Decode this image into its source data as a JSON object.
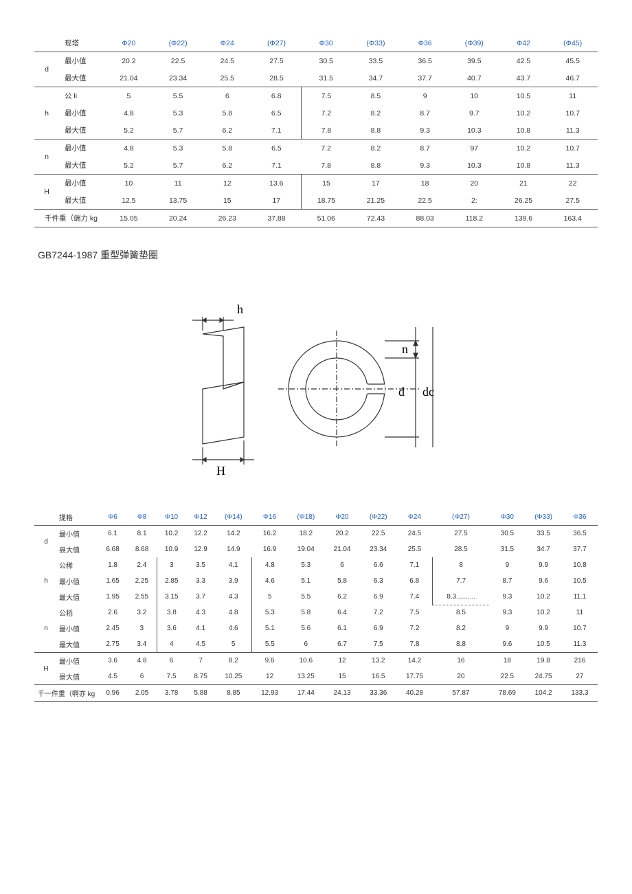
{
  "table1": {
    "header_label": "现塔",
    "headers": [
      "Φ20",
      "(Φ22)",
      "Φ24",
      "(Φ27)",
      "Φ30",
      "(Φ33)",
      "Φ36",
      "(Φ39)",
      "Φ42",
      "(Φ45)"
    ],
    "params": [
      {
        "name": "d",
        "rows": [
          {
            "label": "最小值",
            "values": [
              "20.2",
              "22.5",
              "24.5",
              "27.5",
              "30.5",
              "33.5",
              "36.5",
              "39.5",
              "42.5",
              "45.5"
            ]
          },
          {
            "label": "最大值",
            "values": [
              "21.04",
              "23.34",
              "25.5",
              "28.5",
              "31.5",
              "34.7",
              "37.7",
              "40.7",
              "43.7",
              "46.7"
            ]
          }
        ]
      },
      {
        "name": "h",
        "rows": [
          {
            "label": "公 li",
            "values": [
              "5",
              "5.5",
              "6",
              "6.8",
              "7.5",
              "8.5",
              "9",
              "10",
              "10.5",
              "11"
            ]
          },
          {
            "label": "最小值",
            "values": [
              "4.8",
              "5.3",
              "5.8",
              "6.5",
              "7.2",
              "8.2",
              "8.7",
              "9.7",
              "10.2",
              "10.7"
            ]
          },
          {
            "label": "最大值",
            "values": [
              "5.2",
              "5.7",
              "6.2",
              "7.1",
              "7.8",
              "8.8",
              "9.3",
              "10.3",
              "10.8",
              "11.3"
            ]
          }
        ]
      },
      {
        "name": "n",
        "rows": [
          {
            "label": "最小值",
            "values": [
              "4.8",
              "5.3",
              "5.8",
              "6.5",
              "7.2",
              "8.2",
              "8.7",
              "97",
              "10.2",
              "10.7"
            ]
          },
          {
            "label": "最大值",
            "values": [
              "5.2",
              "5.7",
              "6.2",
              "7.1",
              "7.8",
              "8.8",
              "9.3",
              "10.3",
              "10.8",
              "11.3"
            ]
          }
        ]
      },
      {
        "name": "H",
        "rows": [
          {
            "label": "最小值",
            "values": [
              "10",
              "11",
              "12",
              "13.6",
              "15",
              "17",
              "18",
              "20",
              "21",
              "22"
            ]
          },
          {
            "label": "最大值",
            "values": [
              "12.5",
              "13.75",
              "15",
              "17",
              "18.75",
              "21.25",
              "22.5",
              "2:",
              "26.25",
              "27.5"
            ]
          }
        ]
      }
    ],
    "footer_label": "千件重（端力 kg",
    "footer_values": [
      "15.05",
      "20.24",
      "26.23",
      "37.88",
      "51.06",
      "72.43",
      "88.03",
      "118.2",
      "139.6",
      "163.4"
    ]
  },
  "section_title": "GB7244-1987 重型弹簧垫圈",
  "diagram_labels": {
    "h": "h",
    "H": "H",
    "n": "n",
    "d": "d",
    "dc": "dc"
  },
  "table2": {
    "header_label": "提格",
    "headers": [
      "Φ6",
      "Φ8",
      "Φ10",
      "Φ12",
      "(Φ14)",
      "Φ16",
      "(Φ18)",
      "Φ20",
      "(Φ22)",
      "Φ24",
      "(Φ27)",
      "Φ30",
      "(Φ33)",
      "Φ36"
    ],
    "params": [
      {
        "name": "d",
        "rows": [
          {
            "label": "最小值",
            "values": [
              "6.1",
              "8.1",
              "10.2",
              "12.2",
              "14.2",
              "16.2",
              "18.2",
              "20.2",
              "22.5",
              "24.5",
              "27.5",
              "30.5",
              "33.5",
              "36.5"
            ]
          },
          {
            "label": "县大值",
            "values": [
              "6.68",
              "8.68",
              "10.9",
              "12.9",
              "14.9",
              "16.9",
              "19.04",
              "21.04",
              "23.34",
              "25.5",
              "28.5",
              "31.5",
              "34.7",
              "37.7"
            ]
          }
        ]
      },
      {
        "name": "h",
        "rows": [
          {
            "label": "公稀",
            "values": [
              "1.8",
              "2.4",
              "3",
              "3.5",
              "4.1",
              "4.8",
              "5.3",
              "6",
              "6.6",
              "7.1",
              "8",
              "9",
              "9.9",
              "10.8"
            ]
          },
          {
            "label": "最小值",
            "values": [
              "1.65",
              "2.25",
              "2.85",
              "3.3",
              "3.9",
              "4.6",
              "5.1",
              "5.8",
              "6.3",
              "6.8",
              "7.7",
              "8.7",
              "9.6",
              "10.5"
            ]
          },
          {
            "label": "最大值",
            "values": [
              "1.95",
              "2.55",
              "3.15",
              "3.7",
              "4.3",
              "5",
              "5.5",
              "6.2",
              "6.9",
              "7.4",
              "8.3..........",
              "9.3",
              "10.2",
              "11.1"
            ]
          }
        ]
      },
      {
        "name": "n",
        "rows": [
          {
            "label": "公稻",
            "values": [
              "2.6",
              "3.2",
              "3.8",
              "4.3",
              "4.8",
              "5.3",
              "5.8",
              "6.4",
              "7.2",
              "7.5",
              "8.5",
              "9.3",
              "10.2",
              "11"
            ]
          },
          {
            "label": "最小值",
            "values": [
              "2.45",
              "3",
              "3.6",
              "4.1",
              "4.6",
              "5.1",
              "5.6",
              "6.1",
              "6.9",
              "7.2",
              "8.2",
              "9",
              "9.9",
              "10.7"
            ]
          },
          {
            "label": "最大值",
            "values": [
              "2.75",
              "3.4",
              "4",
              "4.5",
              "5",
              "5.5",
              "6",
              "6.7",
              "7.5",
              "7.8",
              "8.8",
              "9.6",
              "10.5",
              "11.3"
            ]
          }
        ]
      },
      {
        "name": "H",
        "rows": [
          {
            "label": "最小值",
            "values": [
              "3.6",
              "4.8",
              "6",
              "7",
              "8.2",
              "9.6",
              "10.6",
              "12",
              "13.2",
              "14.2",
              "16",
              "18",
              "19.8",
              "216"
            ]
          },
          {
            "label": "景大值",
            "values": [
              "4.5",
              "6",
              "7.5",
              "8.75",
              "10.25",
              "12",
              "13.25",
              "15",
              "16.5",
              "17.75",
              "20",
              "22.5",
              "24.75",
              "27"
            ]
          }
        ]
      }
    ],
    "footer_label": "千一件重（啊亦 kg",
    "footer_values": [
      "0.96",
      "2.05",
      "3.78",
      "5.88",
      "8.85",
      "12.93",
      "17.44",
      "24.13",
      "33.36",
      "40.28",
      "57.87",
      "78.69",
      "104.2",
      "133.3"
    ]
  }
}
